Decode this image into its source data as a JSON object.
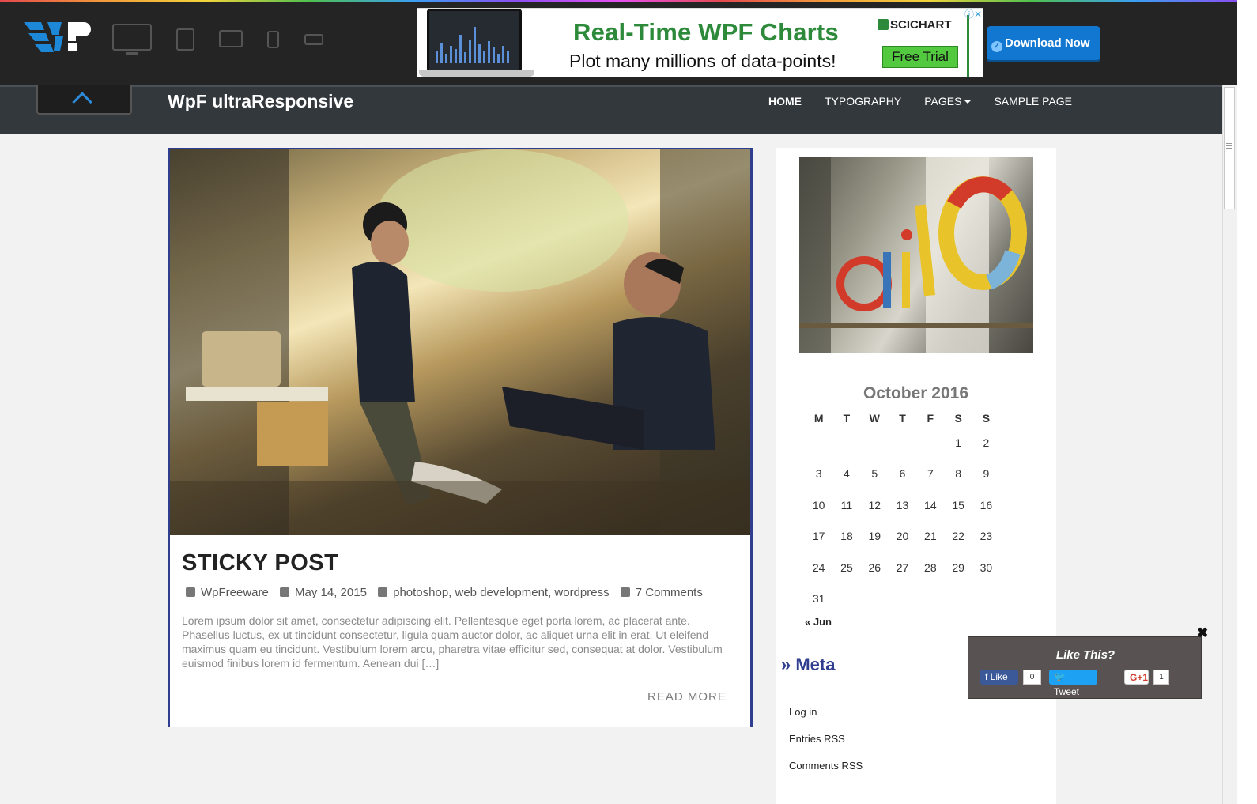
{
  "ad": {
    "headline": "Real-Time WPF Charts",
    "subline": "Plot many millions of data-points!",
    "brand": "SCICHART",
    "cta_trial": "Free Trial",
    "cta_download": "Download Now"
  },
  "header": {
    "site_title": "WpF ultraResponsive",
    "nav": [
      "HOME",
      "TYPOGRAPHY",
      "PAGES",
      "SAMPLE PAGE"
    ]
  },
  "post": {
    "title": "STICKY POST",
    "author": "WpFreeware",
    "date": "May 14, 2015",
    "categories": "photoshop, web development, wordpress",
    "comments": "7 Comments",
    "excerpt": "Lorem ipsum dolor sit amet, consectetur adipiscing elit. Pellentesque eget porta lorem, ac placerat ante. Phasellus luctus, ex ut tincidunt consectetur, ligula quam auctor dolor, ac aliquet urna elit in erat. Ut eleifend maximus quam eu tincidunt. Vestibulum lorem arcu, pharetra vitae efficitur sed, consequat at dolor. Vestibulum euismod finibus lorem id fermentum. Aenean dui […]",
    "read_more": "READ MORE"
  },
  "calendar": {
    "caption": "October 2016",
    "weekdays": [
      "M",
      "T",
      "W",
      "T",
      "F",
      "S",
      "S"
    ],
    "weeks": [
      [
        "",
        "",
        "",
        "",
        "",
        "1",
        "2"
      ],
      [
        "3",
        "4",
        "5",
        "6",
        "7",
        "8",
        "9"
      ],
      [
        "10",
        "11",
        "12",
        "13",
        "14",
        "15",
        "16"
      ],
      [
        "17",
        "18",
        "19",
        "20",
        "21",
        "22",
        "23"
      ],
      [
        "24",
        "25",
        "26",
        "27",
        "28",
        "29",
        "30"
      ],
      [
        "31",
        "",
        "",
        "",
        "",
        "",
        ""
      ]
    ],
    "prev": "« Jun"
  },
  "meta": {
    "heading": "Meta",
    "links": [
      {
        "text": "Log in",
        "abbr": ""
      },
      {
        "text": "Entries ",
        "abbr": "RSS"
      },
      {
        "text": "Comments ",
        "abbr": "RSS"
      }
    ]
  },
  "like_popup": {
    "title": "Like This?",
    "facebook": "Like",
    "facebook_count": "0",
    "twitter": "Tweet",
    "gplus": "G+1",
    "gplus_count": "1"
  }
}
